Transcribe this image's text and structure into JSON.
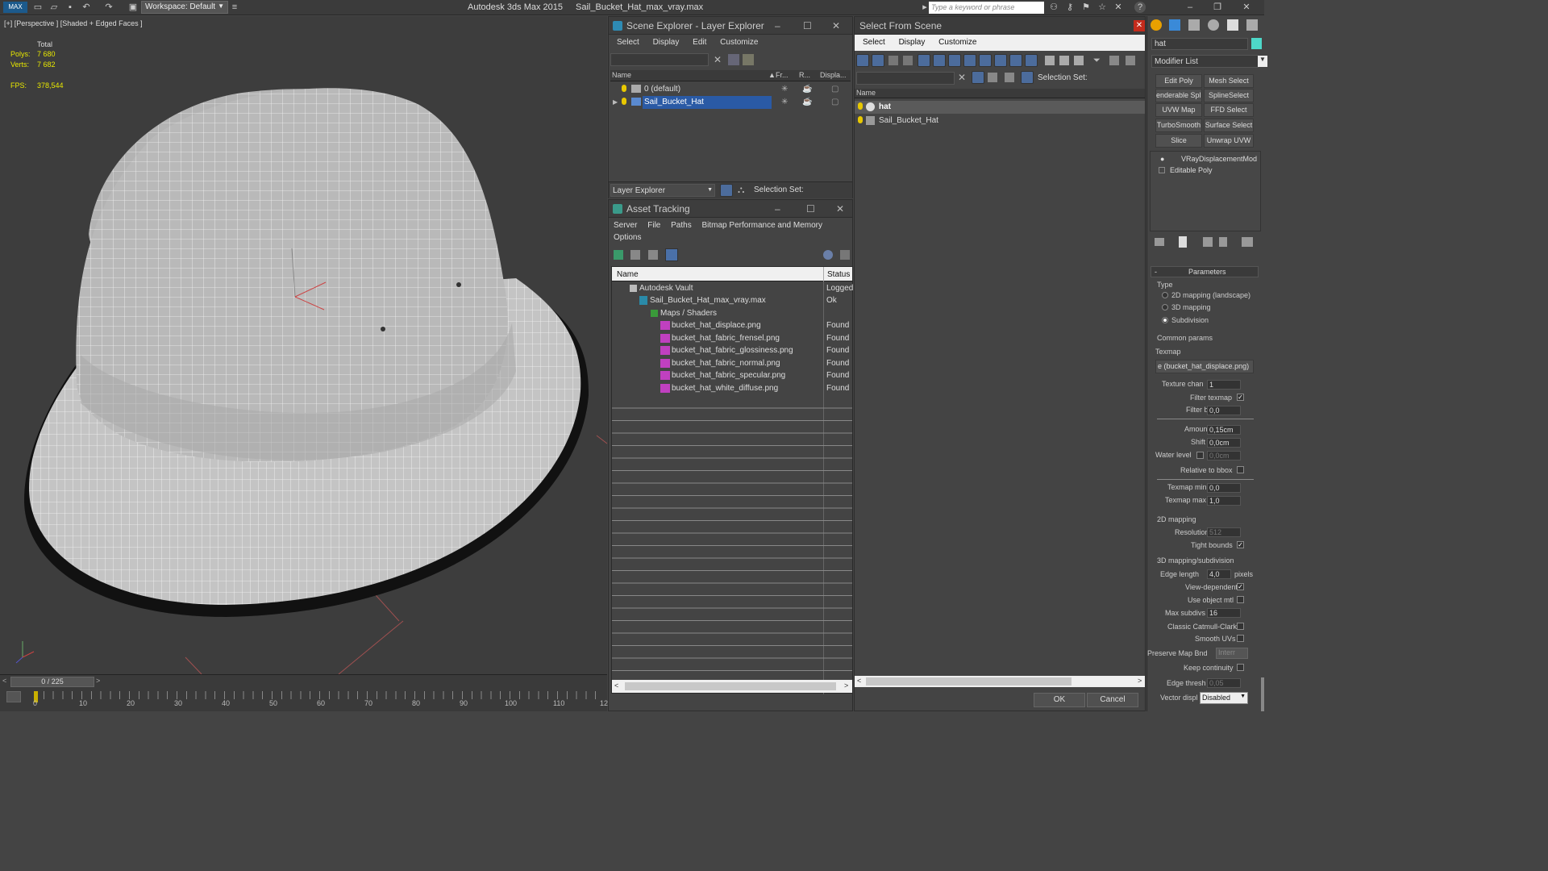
{
  "titlebar": {
    "workspace": "Workspace: Default",
    "app_title": "Autodesk 3ds Max  2015",
    "file_title": "Sail_Bucket_Hat_max_vray.max",
    "search_placeholder": "Type a keyword or phrase"
  },
  "viewport": {
    "label": "[+] [Perspective ] [Shaded + Edged Faces ]",
    "total_label": "Total",
    "polys_label": "Polys:",
    "polys_value": "7 680",
    "verts_label": "Verts:",
    "verts_value": "7 682",
    "fps_label": "FPS:",
    "fps_value": "378,544"
  },
  "timeline": {
    "frame": "0 / 225",
    "ticks": [
      "0",
      "10",
      "20",
      "30",
      "40",
      "50",
      "60",
      "70",
      "80",
      "90",
      "100",
      "110",
      "12"
    ]
  },
  "scene_explorer": {
    "title": "Scene Explorer - Layer Explorer",
    "menu": [
      "Select",
      "Display",
      "Edit",
      "Customize"
    ],
    "columns": {
      "name": "Name",
      "freeze": "Fr...",
      "render": "R...",
      "display": "Displa..."
    },
    "rows": [
      {
        "label": "0 (default)",
        "selected": false
      },
      {
        "label": "Sail_Bucket_Hat",
        "selected": true
      }
    ],
    "footer_dropdown": "Layer Explorer",
    "footer_selection": "Selection Set:"
  },
  "asset_tracking": {
    "title": "Asset Tracking",
    "menu": [
      "Server",
      "File",
      "Paths",
      "Bitmap Performance and Memory"
    ],
    "menu2": "Options",
    "col_name": "Name",
    "col_status": "Status",
    "rows": [
      {
        "name": "Autodesk Vault",
        "status": "Logged"
      },
      {
        "name": "Sail_Bucket_Hat_max_vray.max",
        "status": "Ok"
      },
      {
        "name": "Maps / Shaders",
        "status": ""
      },
      {
        "name": "bucket_hat_displace.png",
        "status": "Found"
      },
      {
        "name": "bucket_hat_fabric_frensel.png",
        "status": "Found"
      },
      {
        "name": "bucket_hat_fabric_glossiness.png",
        "status": "Found"
      },
      {
        "name": "bucket_hat_fabric_normal.png",
        "status": "Found"
      },
      {
        "name": "bucket_hat_fabric_specular.png",
        "status": "Found"
      },
      {
        "name": "bucket_hat_white_diffuse.png",
        "status": "Found"
      }
    ]
  },
  "select_from_scene": {
    "title": "Select From Scene",
    "menu": [
      "Select",
      "Display",
      "Customize"
    ],
    "selection_set": "Selection Set:",
    "col_name": "Name",
    "rows": [
      {
        "label": "hat",
        "selected": true
      },
      {
        "label": "Sail_Bucket_Hat",
        "selected": false
      }
    ],
    "ok": "OK",
    "cancel": "Cancel"
  },
  "command_panel": {
    "name_field": "hat",
    "modifier_list": "Modifier List",
    "buttons": [
      "Edit Poly",
      "Mesh Select",
      "enderable Splir",
      "SplineSelect",
      "UVW Map",
      "FFD Select",
      "TurboSmooth",
      "Surface Select",
      "Slice",
      "Unwrap UVW"
    ],
    "stack": [
      "VRayDisplacementMod",
      "Editable Poly"
    ],
    "params_title": "Parameters",
    "type_label": "Type",
    "type_options": [
      "2D mapping (landscape)",
      "3D mapping",
      "Subdivision"
    ],
    "common_label": "Common params",
    "texmap_label": "Texmap",
    "texmap_value": "e (bucket_hat_displace.png)",
    "texture_chan_label": "Texture chan",
    "texture_chan_value": "1",
    "filter_texmap_label": "Filter texmap",
    "filter_blur_label": "Filter blur",
    "filter_blur_value": "0,0",
    "amount_label": "Amount",
    "amount_value": "0,15cm",
    "shift_label": "Shift",
    "shift_value": "0,0cm",
    "water_label": "Water level",
    "water_value": "0,0cm",
    "relative_label": "Relative to bbox",
    "texmap_min_label": "Texmap min",
    "texmap_min_value": "0,0",
    "texmap_max_label": "Texmap max",
    "texmap_max_value": "1,0",
    "map2d_label": "2D mapping",
    "resolution_label": "Resolution",
    "resolution_value": "512",
    "tight_label": "Tight bounds",
    "map3d_label": "3D mapping/subdivision",
    "edge_len_label": "Edge length",
    "edge_len_value": "4,0",
    "pixels_label": "pixels",
    "view_dep_label": "View-dependent",
    "use_obj_label": "Use object mtl",
    "max_subdivs_label": "Max subdivs",
    "max_subdivs_value": "16",
    "catmull_label": "Classic Catmull-Clark",
    "smooth_uv_label": "Smooth UVs",
    "preserve_label": "Preserve Map Bnd",
    "preserve_value": "Interr",
    "keep_label": "Keep continuity",
    "edge_thresh_label": "Edge thresh",
    "edge_thresh_value": "0,05",
    "vector_label": "Vector displ",
    "vector_value": "Disabled"
  }
}
